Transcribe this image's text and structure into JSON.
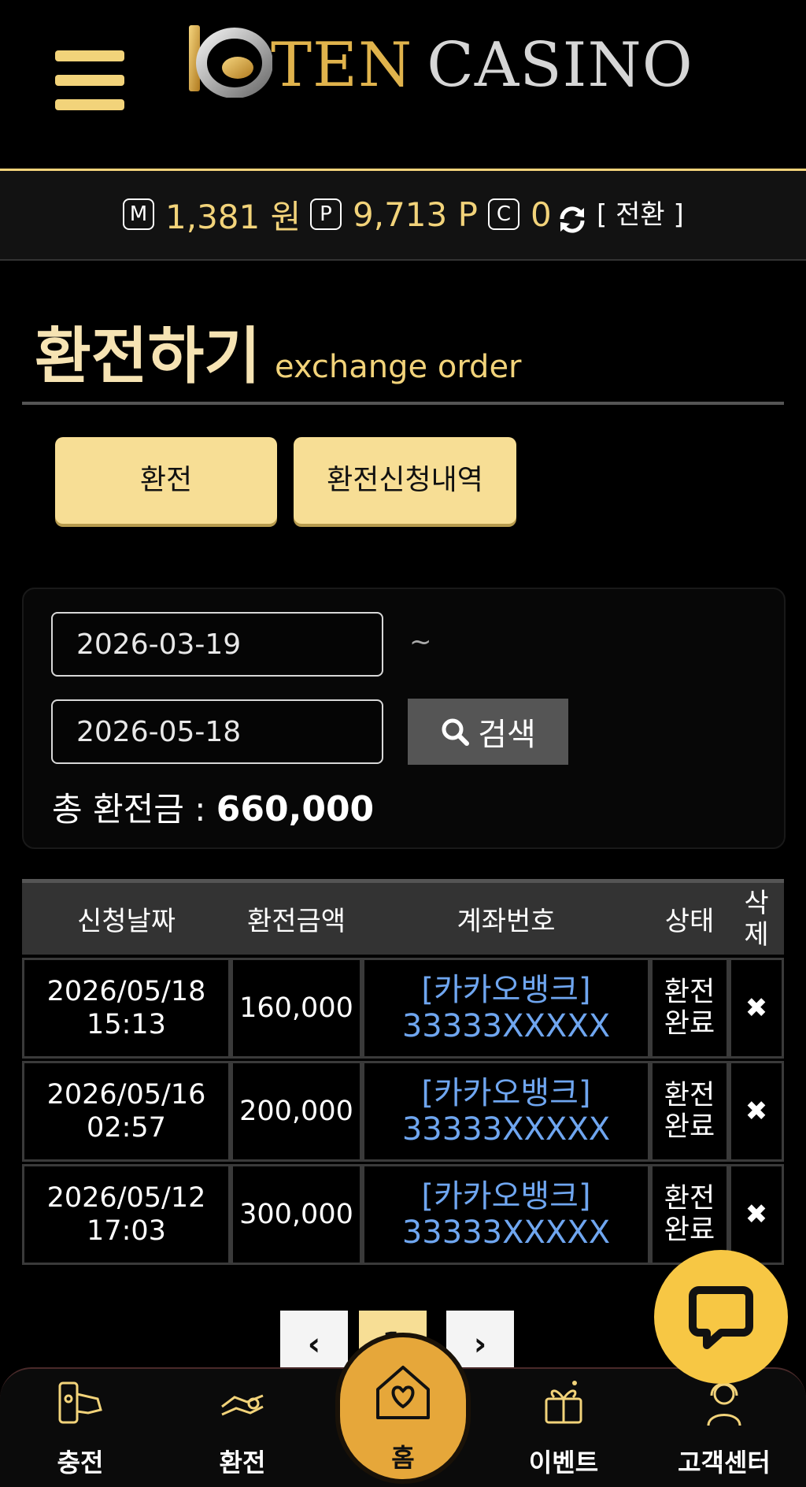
{
  "header": {
    "brand": {
      "ten": "TEN",
      "casino": "CASINO"
    }
  },
  "balance": {
    "money_icon": "M",
    "money": "1,381 원",
    "point_icon": "P",
    "point": "9,713 P",
    "coin_icon": "C",
    "coin": "0",
    "convert_label": "[ 전환 ]"
  },
  "page": {
    "title_ko": "환전하기",
    "title_en": "exchange order"
  },
  "tabs": [
    "환전",
    "환전신청내역"
  ],
  "search": {
    "date_from": "2026-03-19",
    "tilde": "~",
    "date_to": "2026-05-18",
    "button_label": "검색",
    "total_label": "총 환전금 : ",
    "total_value": "660,000"
  },
  "table": {
    "headers": [
      "신청날짜",
      "환전금액",
      "계좌번호",
      "상태",
      "삭\n제"
    ],
    "rows": [
      {
        "date": "2026/05/18",
        "time": "15:13",
        "amount": "160,000",
        "bank": "[카카오뱅크]",
        "account": "33333XXXXX",
        "status_1": "환전",
        "status_2": "완료",
        "delete": "✖"
      },
      {
        "date": "2026/05/16",
        "time": "02:57",
        "amount": "200,000",
        "bank": "[카카오뱅크]",
        "account": "33333XXXXX",
        "status_1": "환전",
        "status_2": "완료",
        "delete": "✖"
      },
      {
        "date": "2026/05/12",
        "time": "17:03",
        "amount": "300,000",
        "bank": "[카카오뱅크]",
        "account": "33333XXXXX",
        "status_1": "환전",
        "status_2": "완료",
        "delete": "✖"
      }
    ]
  },
  "pagination": {
    "prev": "‹",
    "current": "1",
    "next": "›"
  },
  "bottom_nav": {
    "charge": "충전",
    "exchange": "환전",
    "home": "홈",
    "event": "이벤트",
    "support": "고객센터"
  },
  "colors": {
    "gold": "#f2d37a",
    "button": "#f7de95",
    "link": "#6fa6f0",
    "fab": "#f7c744",
    "home": "#e6a73a"
  }
}
